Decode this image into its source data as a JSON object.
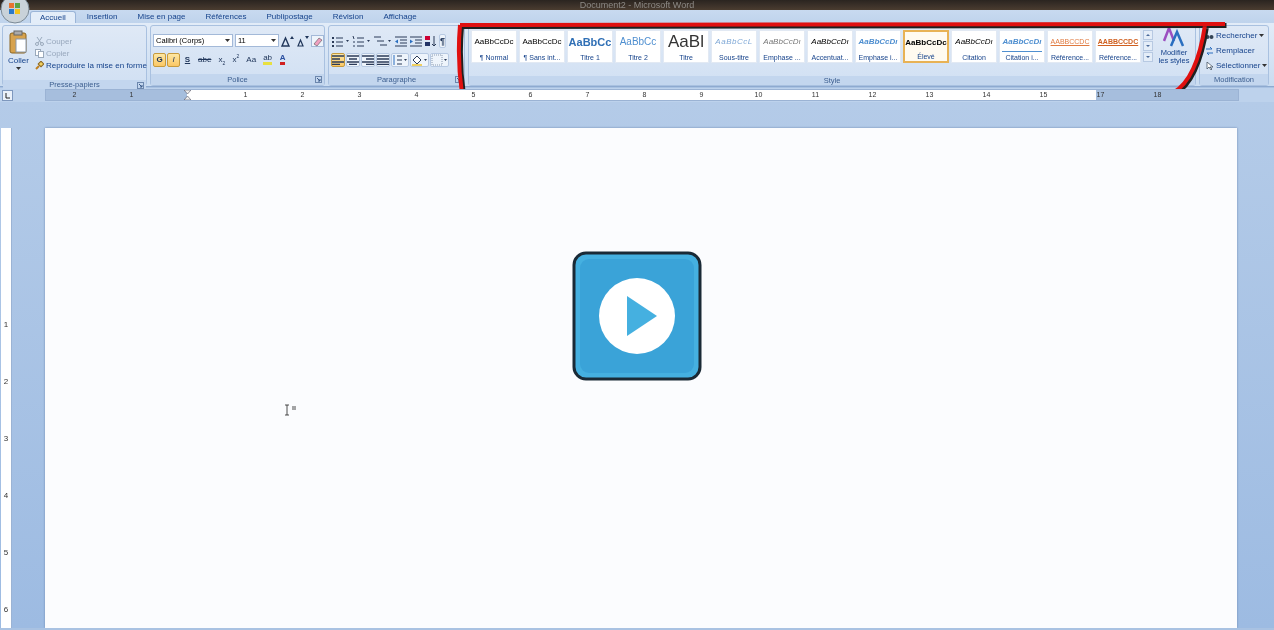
{
  "window": {
    "title": "Document2 - Microsoft Word"
  },
  "tabs": [
    {
      "label": "Accueil",
      "selected": true
    },
    {
      "label": "Insertion",
      "selected": false
    },
    {
      "label": "Mise en page",
      "selected": false
    },
    {
      "label": "Références",
      "selected": false
    },
    {
      "label": "Publipostage",
      "selected": false
    },
    {
      "label": "Révision",
      "selected": false
    },
    {
      "label": "Affichage",
      "selected": false
    }
  ],
  "clipboard": {
    "group": "Presse-papiers",
    "paste": "Coller",
    "items": [
      {
        "label": "Couper",
        "kind": "cut",
        "disabled": true
      },
      {
        "label": "Copier",
        "kind": "copy",
        "disabled": true
      },
      {
        "label": "Reproduire la mise en forme",
        "kind": "brush",
        "disabled": false
      }
    ]
  },
  "font": {
    "group": "Police",
    "name": "Calibri (Corps)",
    "size": "11",
    "buttons": [
      {
        "label": "G",
        "kind": "bold",
        "selected": true
      },
      {
        "label": "I",
        "kind": "italic",
        "selected": true
      },
      {
        "label": "S",
        "kind": "underline",
        "selected": false
      },
      {
        "label": "abe",
        "kind": "strike",
        "selected": false
      },
      {
        "label": "x$_{2}$",
        "kind": "sub",
        "selected": false
      },
      {
        "label": "x$^{2}$",
        "kind": "sup",
        "selected": false
      },
      {
        "label": "Aa",
        "kind": "case",
        "selected": false
      },
      {
        "label": "ab",
        "kind": "highlight",
        "selected": false
      },
      {
        "label": "A",
        "kind": "color",
        "selected": false
      }
    ]
  },
  "paragraph": {
    "group": "Paragraphe",
    "row1": [
      {
        "kind": "bullets"
      },
      {
        "kind": "numbering"
      },
      {
        "kind": "multilevel"
      },
      {
        "kind": "outdent"
      },
      {
        "kind": "indent"
      },
      {
        "kind": "sort"
      },
      {
        "kind": "pilcrow",
        "label": "¶"
      }
    ],
    "row2": [
      {
        "kind": "left",
        "selected": true
      },
      {
        "kind": "center",
        "selected": false
      },
      {
        "kind": "right",
        "selected": false
      },
      {
        "kind": "justify",
        "selected": false
      },
      {
        "kind": "spacing",
        "selected": false
      },
      {
        "kind": "shading",
        "selected": false
      },
      {
        "kind": "borders",
        "selected": false
      }
    ]
  },
  "styles": {
    "group": "Style",
    "change": "Modifier les styles",
    "items": [
      {
        "preview": "AaBbCcDc",
        "label": "¶ Normal",
        "kind": "normal",
        "selected": false
      },
      {
        "preview": "AaBbCcDc",
        "label": "¶ Sans int...",
        "kind": "normal",
        "selected": false
      },
      {
        "preview": "AaBbCc",
        "label": "Titre 1",
        "kind": "heading1",
        "selected": false
      },
      {
        "preview": "AaBbCc",
        "label": "Titre 2",
        "kind": "heading2",
        "selected": false
      },
      {
        "preview": "AaBl",
        "label": "Titre",
        "kind": "title",
        "selected": false
      },
      {
        "preview": "AaBbCcL",
        "label": "Sous-titre",
        "kind": "subtitle",
        "selected": false
      },
      {
        "preview": "AaBbCcDı",
        "label": "Emphase ...",
        "kind": "subtle",
        "selected": false
      },
      {
        "preview": "AaBbCcDı",
        "label": "Accentuat...",
        "kind": "emphasis",
        "selected": false
      },
      {
        "preview": "AaBbCcDı",
        "label": "Emphase i...",
        "kind": "intense",
        "selected": false
      },
      {
        "preview": "AaBbCcDc",
        "label": "Élevé",
        "kind": "strong",
        "selected": true
      },
      {
        "preview": "AaBbCcDı",
        "label": "Citation",
        "kind": "quote",
        "selected": false
      },
      {
        "preview": "AaBbCcDı",
        "label": "Citation i...",
        "kind": "quoteintense",
        "selected": false
      },
      {
        "preview": "AABBCCDC",
        "label": "Référence...",
        "kind": "refsubtle",
        "selected": false
      },
      {
        "preview": "AABBCCDC",
        "label": "Référence...",
        "kind": "refintense",
        "selected": false
      }
    ]
  },
  "editing": {
    "group": "Modification",
    "items": [
      {
        "label": "Rechercher",
        "kind": "find",
        "dropdown": true
      },
      {
        "label": "Remplacer",
        "kind": "replace",
        "dropdown": false
      },
      {
        "label": "Sélectionner",
        "kind": "select",
        "dropdown": true
      }
    ]
  },
  "ruler": {
    "ticks": [
      "2",
      "1",
      "1",
      "2",
      "3",
      "4",
      "5",
      "6",
      "7",
      "8",
      "9",
      "10",
      "11",
      "12",
      "13",
      "14",
      "15",
      "17",
      "18"
    ]
  },
  "vertical_ruler": {
    "ticks": [
      "1",
      "2",
      "3",
      "4",
      "5",
      "6"
    ]
  }
}
